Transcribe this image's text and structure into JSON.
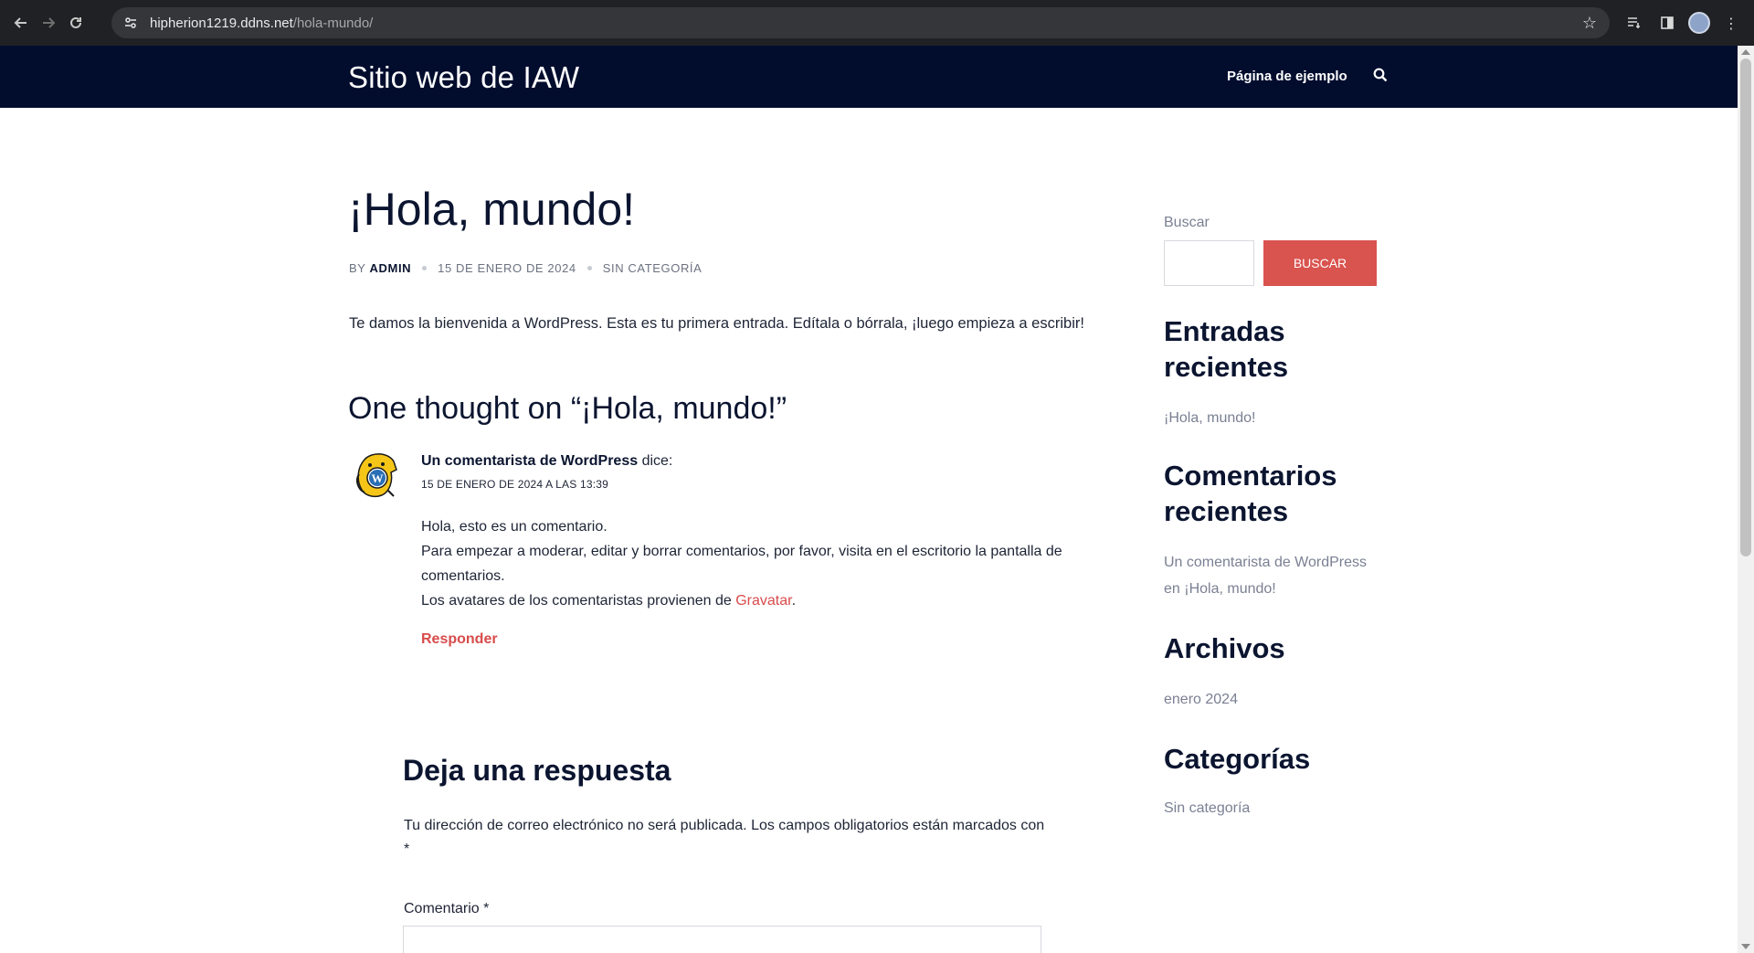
{
  "browser": {
    "url_host": "hipherion1219.ddns.net",
    "url_path": "/hola-mundo/"
  },
  "header": {
    "site_title": "Sitio web de IAW",
    "nav_item": "Página de ejemplo"
  },
  "post": {
    "title": "¡Hola, mundo!",
    "meta_by": "BY",
    "meta_author": "ADMIN",
    "meta_date": "15 DE ENERO DE 2024",
    "meta_category": "SIN CATEGORÍA",
    "content": "Te damos la bienvenida a WordPress. Esta es tu primera entrada. Edítala o bórrala, ¡luego empieza a escribir!"
  },
  "comments": {
    "title": "One thought on “¡Hola, mundo!”",
    "items": [
      {
        "author": "Un comentarista de WordPress",
        "says": "dice:",
        "date": "15 DE ENERO DE 2024 A LAS 13:39",
        "line1": "Hola, esto es un comentario.",
        "line2": "Para empezar a moderar, editar y borrar comentarios, por favor, visita en el escritorio la pantalla de comentarios.",
        "line3_prefix": "Los avatares de los comentaristas provienen de ",
        "line3_link": "Gravatar",
        "line3_suffix": ".",
        "reply": "Responder"
      }
    ]
  },
  "reply_form": {
    "title": "Deja una respuesta",
    "notes": "Tu dirección de correo electrónico no será publicada. Los campos obligatorios están marcados con",
    "required_mark": "*",
    "comment_label": "Comentario *"
  },
  "sidebar": {
    "search_label": "Buscar",
    "search_button": "BUSCAR",
    "recent_posts_title": "Entradas recientes",
    "recent_posts": [
      "¡Hola, mundo!"
    ],
    "recent_comments_title": "Comentarios recientes",
    "recent_comment": "Un comentarista de WordPress en ¡Hola, mundo!",
    "archives_title": "Archivos",
    "archives": [
      "enero 2024"
    ],
    "categories_title": "Categorías",
    "categories": [
      "Sin categoría"
    ]
  },
  "colors": {
    "header_bg": "#020d2e",
    "accent": "#d9534f",
    "browser_bg": "#202124"
  },
  "icons": [
    "back-arrow-icon",
    "forward-arrow-icon",
    "reload-icon",
    "site-info-icon",
    "bookmark-star-icon",
    "reading-list-icon",
    "side-panel-icon",
    "profile-avatar-icon",
    "menu-kebab-icon",
    "search-icon"
  ]
}
